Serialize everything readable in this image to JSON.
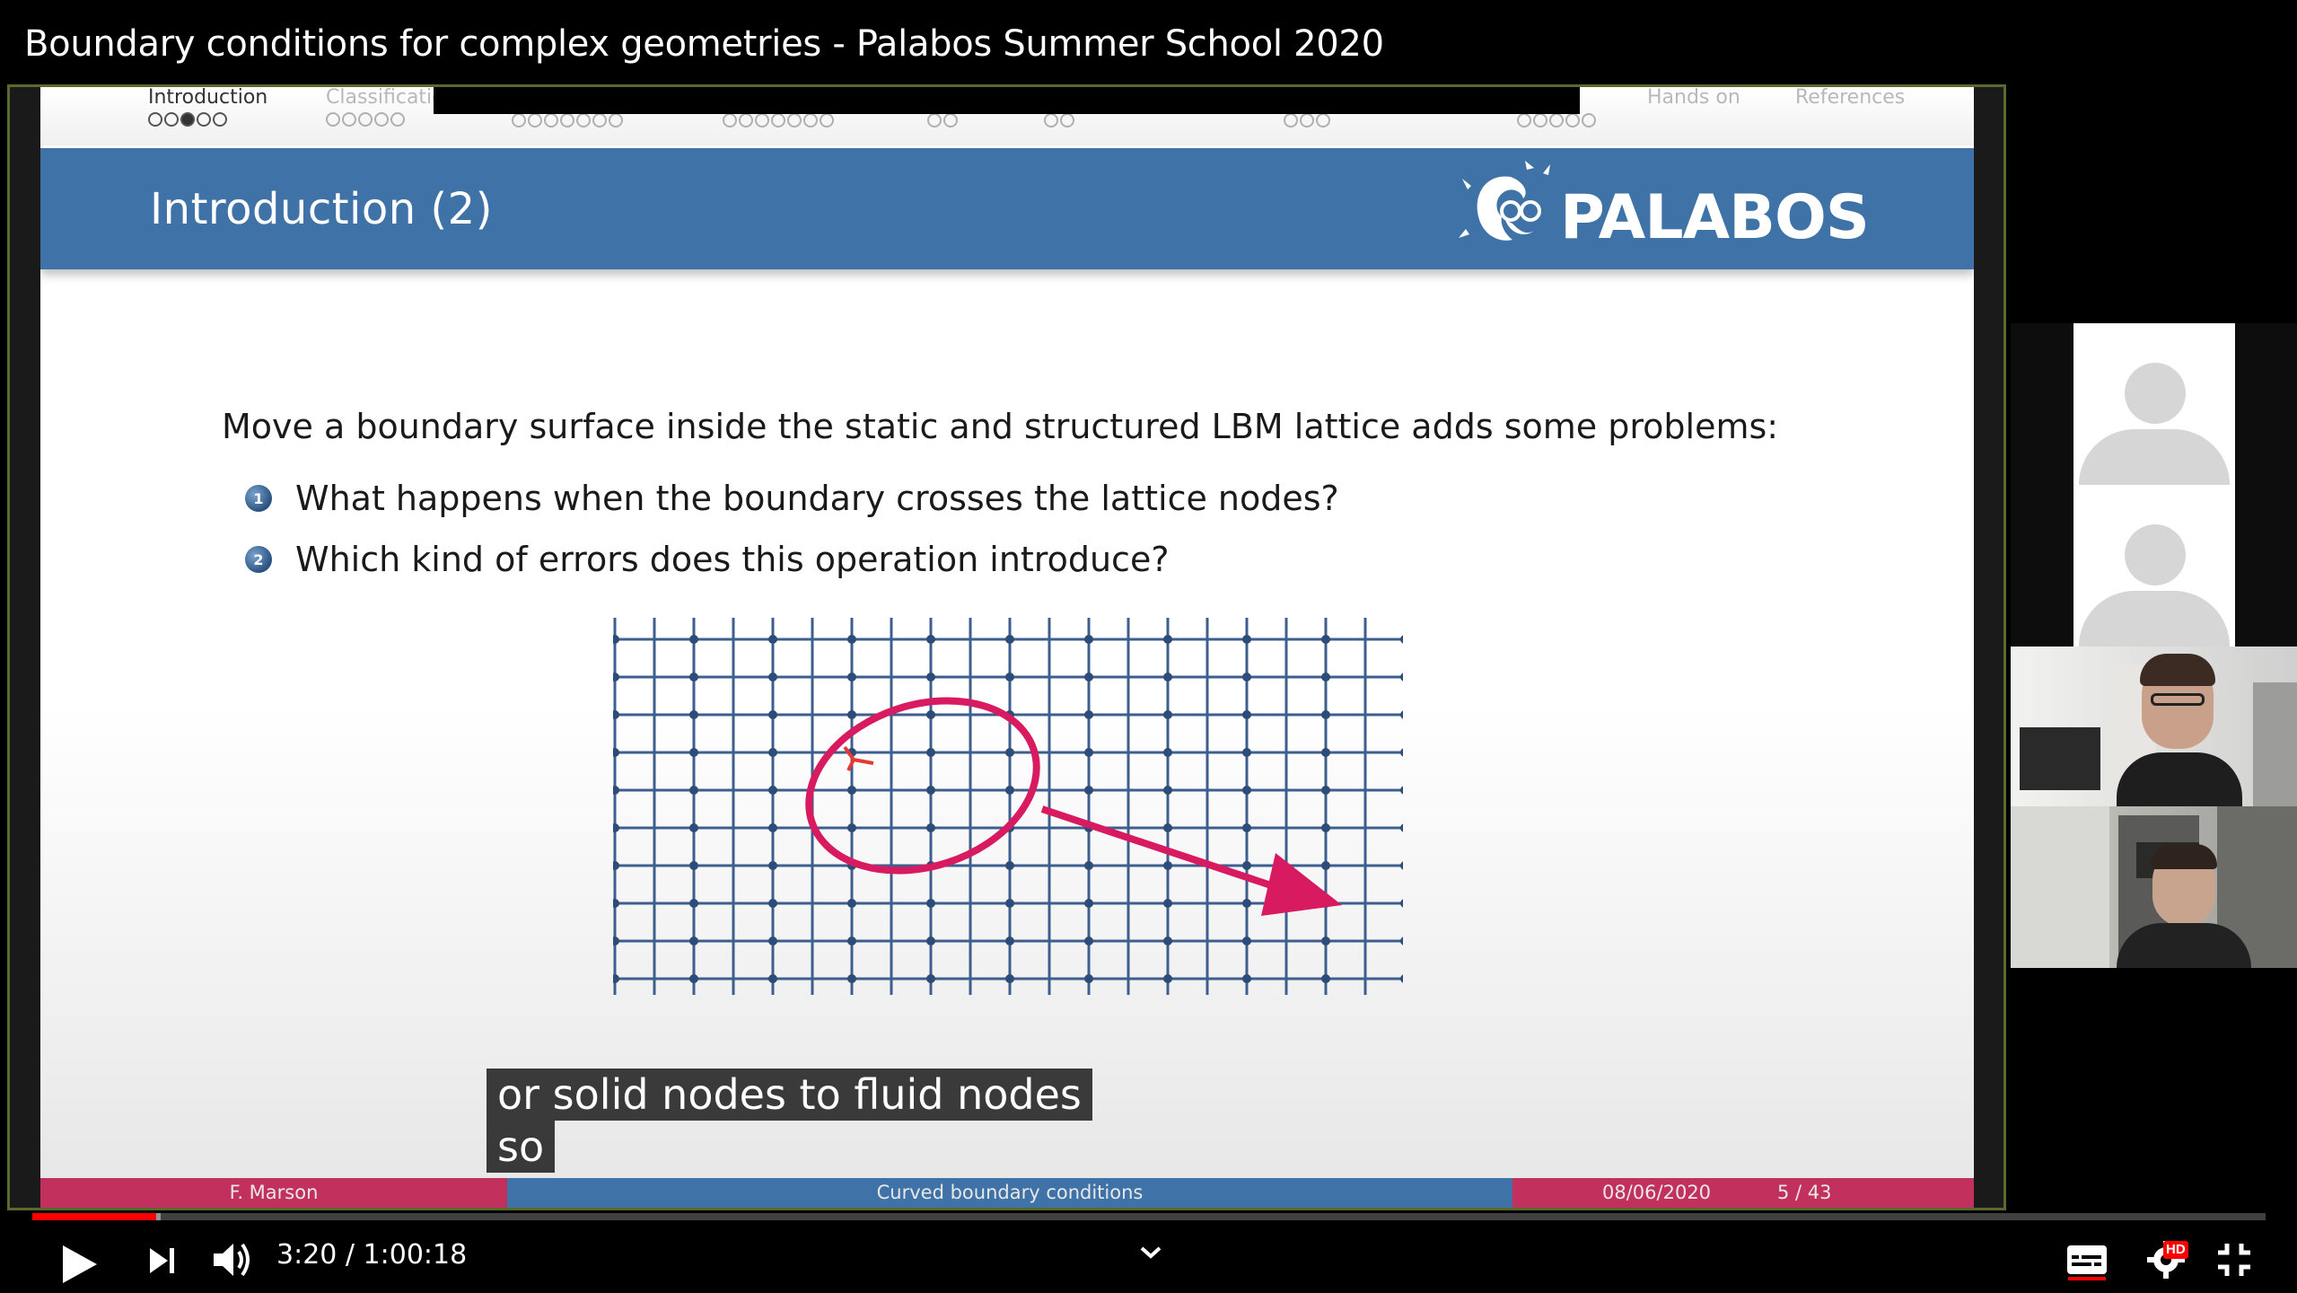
{
  "video": {
    "title": "Boundary conditions for complex geometries - Palabos Summer School 2020"
  },
  "slide": {
    "nav": [
      {
        "label": "Introduction",
        "dots": 5,
        "filled": 3,
        "active": true
      },
      {
        "label": "Classificatio",
        "dots": 5,
        "filled": 0,
        "active": false
      },
      {
        "label": "",
        "dots": 7,
        "filled": 0,
        "active": false
      },
      {
        "label": "",
        "dots": 7,
        "filled": 0,
        "active": false
      },
      {
        "label": "",
        "dots": 2,
        "filled": 0,
        "active": false
      },
      {
        "label": "",
        "dots": 2,
        "filled": 0,
        "active": false
      },
      {
        "label": "",
        "dots": 3,
        "filled": 0,
        "active": false
      },
      {
        "label": "",
        "dots": 5,
        "filled": 0,
        "active": false
      },
      {
        "label": "Hands on",
        "dots": 0,
        "filled": 0,
        "active": false
      },
      {
        "label": "References",
        "dots": 0,
        "filled": 0,
        "active": false
      }
    ],
    "title": "Introduction (2)",
    "logo_text": "PALABOS",
    "intro": "Move a boundary surface inside the static and structured LBM lattice adds some problems:",
    "items": [
      {
        "num": "1",
        "text": "What happens when the boundary crosses the lattice nodes?"
      },
      {
        "num": "2",
        "text": "Which kind of errors does this operation introduce?"
      }
    ],
    "footer": {
      "author": "F. Marson",
      "topic": "Curved boundary conditions",
      "date": "08/06/2020",
      "page": "5 / 43"
    }
  },
  "captions": {
    "line1": "or solid nodes to fluid nodes",
    "line2": "so"
  },
  "player": {
    "time": "3:20 / 1:00:18",
    "played_fraction": 0.0553,
    "buffered_fraction": 0.0575,
    "hd_badge": "HD"
  },
  "colors": {
    "slide_band": "#3f72a6",
    "footer_accent": "#c2305e",
    "annotation": "#d81b60",
    "progress": "#ff0000"
  }
}
